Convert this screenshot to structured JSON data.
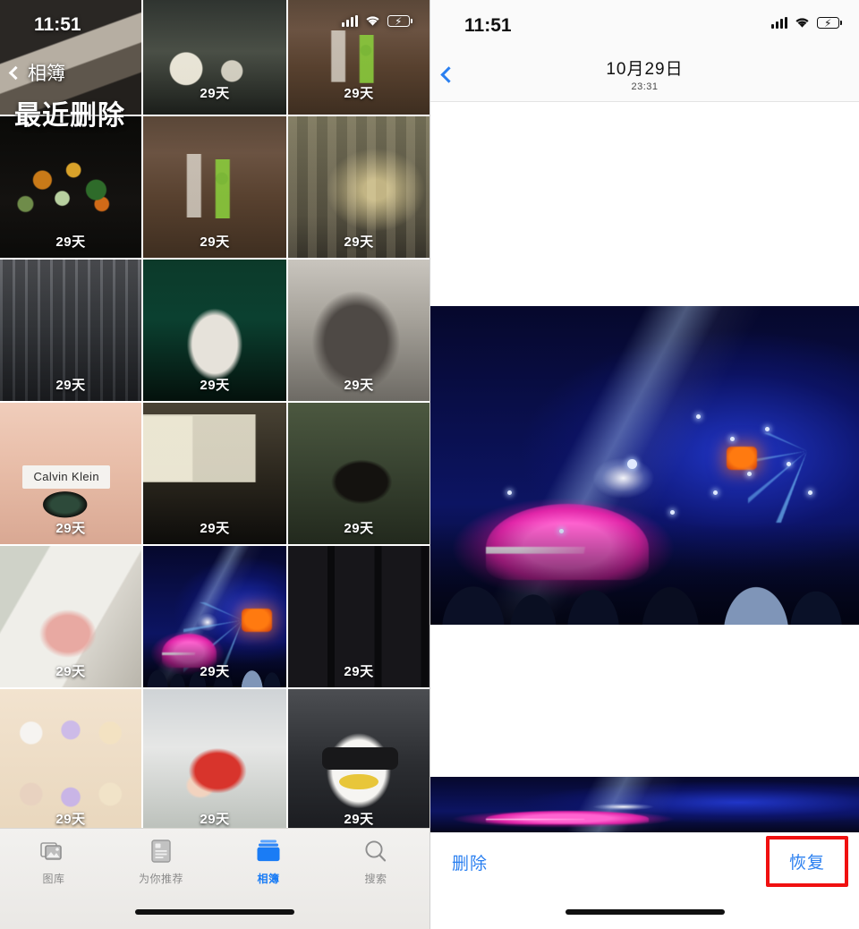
{
  "left": {
    "status": {
      "time": "11:51",
      "signal_icon": "cellular-bars-icon",
      "wifi_icon": "wifi-icon",
      "battery_icon": "battery-charging-icon"
    },
    "nav": {
      "back_label": "相簿",
      "title": "最近删除"
    },
    "grid": {
      "day_suffix": "天",
      "photos": [
        {
          "name": "photo-hands-table",
          "days": "",
          "bg": "hands-bg"
        },
        {
          "name": "photo-arcade-claw",
          "days": "29天",
          "bg": "arcade-bg"
        },
        {
          "name": "photo-street-night",
          "days": "29天",
          "bg": "street-bg"
        },
        {
          "name": "photo-flowers-bouquet",
          "days": "29天",
          "bg": "flowers-bg"
        },
        {
          "name": "photo-street-people",
          "days": "29天",
          "bg": "street-bg"
        },
        {
          "name": "photo-curtain-statue",
          "days": "29天",
          "bg": "curtain-bg"
        },
        {
          "name": "photo-city-buildings",
          "days": "29天",
          "bg": "city-bg"
        },
        {
          "name": "photo-teddy-bear",
          "days": "29天",
          "bg": "bear-bg"
        },
        {
          "name": "photo-sphynx-cat",
          "days": "29天",
          "bg": "cat-bg"
        },
        {
          "name": "photo-eye-calvin-klein",
          "days": "29天",
          "bg": "eye-bg",
          "overlay_text": "Calvin Klein"
        },
        {
          "name": "photo-bus-interior",
          "days": "29天",
          "bg": "bus-bg"
        },
        {
          "name": "photo-park-bench",
          "days": "29天",
          "bg": "park-bg"
        },
        {
          "name": "photo-pink-sofa-toy",
          "days": "29天",
          "bg": "sofa-bg"
        },
        {
          "name": "photo-concert-stage",
          "days": "29天",
          "bg": "concert"
        },
        {
          "name": "photo-display-shelf",
          "days": "29天",
          "bg": "shelf-bg"
        },
        {
          "name": "photo-sticker-sheet",
          "days": "29天",
          "bg": "sticker-bg"
        },
        {
          "name": "photo-cartoon-mermaid",
          "days": "29天",
          "bg": "mermaid-bg"
        },
        {
          "name": "photo-penguin-sunglasses",
          "days": "29天",
          "bg": "penguin-bg"
        }
      ]
    },
    "tabs": [
      {
        "label": "图库",
        "icon": "photos-library-icon",
        "active": false
      },
      {
        "label": "为你推荐",
        "icon": "for-you-icon",
        "active": false
      },
      {
        "label": "相簿",
        "icon": "albums-icon",
        "active": true
      },
      {
        "label": "搜索",
        "icon": "search-icon",
        "active": false
      }
    ]
  },
  "right": {
    "status": {
      "time": "11:51",
      "signal_icon": "cellular-bars-icon",
      "wifi_icon": "wifi-icon",
      "battery_icon": "battery-charging-icon"
    },
    "nav": {
      "back_icon": "chevron-left-icon",
      "title": "10月29日",
      "subtitle": "23:31"
    },
    "photo": {
      "name": "photo-concert-stage-large"
    },
    "filmstrip": {
      "thumbs": [
        {
          "name": "filmstrip-thumb-1",
          "bg": "dark-bg"
        },
        {
          "name": "filmstrip-thumb-2",
          "bg": "city-bg"
        },
        {
          "name": "filmstrip-thumb-3",
          "bg": "dark-bg"
        },
        {
          "name": "filmstrip-thumb-4",
          "bg": "sofa-bg"
        },
        {
          "name": "filmstrip-thumb-5",
          "bg": "bus-bg"
        },
        {
          "name": "filmstrip-thumb-6",
          "bg": "park-bg"
        },
        {
          "name": "filmstrip-thumb-7",
          "bg": "eye-bg"
        }
      ],
      "selected": {
        "name": "filmstrip-thumb-selected",
        "bg": "concert"
      },
      "thumbs_after": [
        {
          "name": "filmstrip-thumb-8",
          "bg": "shelf-bg"
        },
        {
          "name": "filmstrip-thumb-9",
          "bg": "sticker-bg"
        },
        {
          "name": "filmstrip-thumb-10",
          "bg": "mermaid-bg"
        },
        {
          "name": "filmstrip-thumb-11",
          "bg": "penguin-bg"
        },
        {
          "name": "filmstrip-thumb-12",
          "bg": "park-bg"
        },
        {
          "name": "filmstrip-thumb-13",
          "bg": "flowers-bg"
        },
        {
          "name": "filmstrip-thumb-14",
          "bg": "street-bg"
        },
        {
          "name": "filmstrip-thumb-15",
          "bg": "concert"
        }
      ]
    },
    "toolbar": {
      "delete_label": "删除",
      "restore_label": "恢复"
    },
    "highlight_color": "#f01010",
    "accent_color": "#2a7ff0"
  }
}
